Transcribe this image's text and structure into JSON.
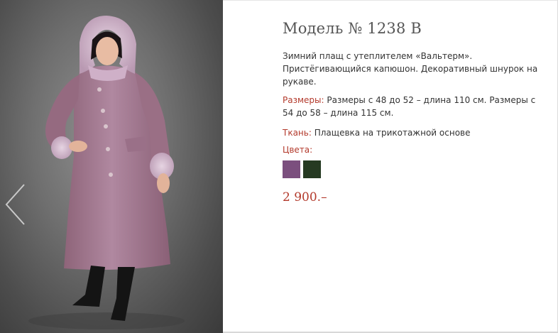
{
  "product": {
    "title": "Модель № 1238 В",
    "description": "Зимний плащ с утеплителем «Вальтерм».  Пристёгивающийся  капюшон. Декоративный шнурок на рукаве.",
    "sizes_label": "Размеры:",
    "sizes_text": "Размеры с 48 до 52 – длина 110 см. Размеры с 54 до 58 – длина 115 см.",
    "fabric_label": "Ткань:",
    "fabric_text": "Плащевка на трикотажной основе",
    "colors_label": "Цвета:",
    "colors": [
      {
        "name": "lilac-swatch",
        "hex": "#7b4f7e"
      },
      {
        "name": "dark-green-swatch",
        "hex": "#263a22"
      }
    ],
    "price": "2 900.–"
  },
  "slider": {
    "prev_icon": "chevron-left-icon"
  },
  "theme": {
    "accent": "#b33a2c",
    "coat_color": "#a47a90",
    "fur_color": "#d2b6cc"
  }
}
